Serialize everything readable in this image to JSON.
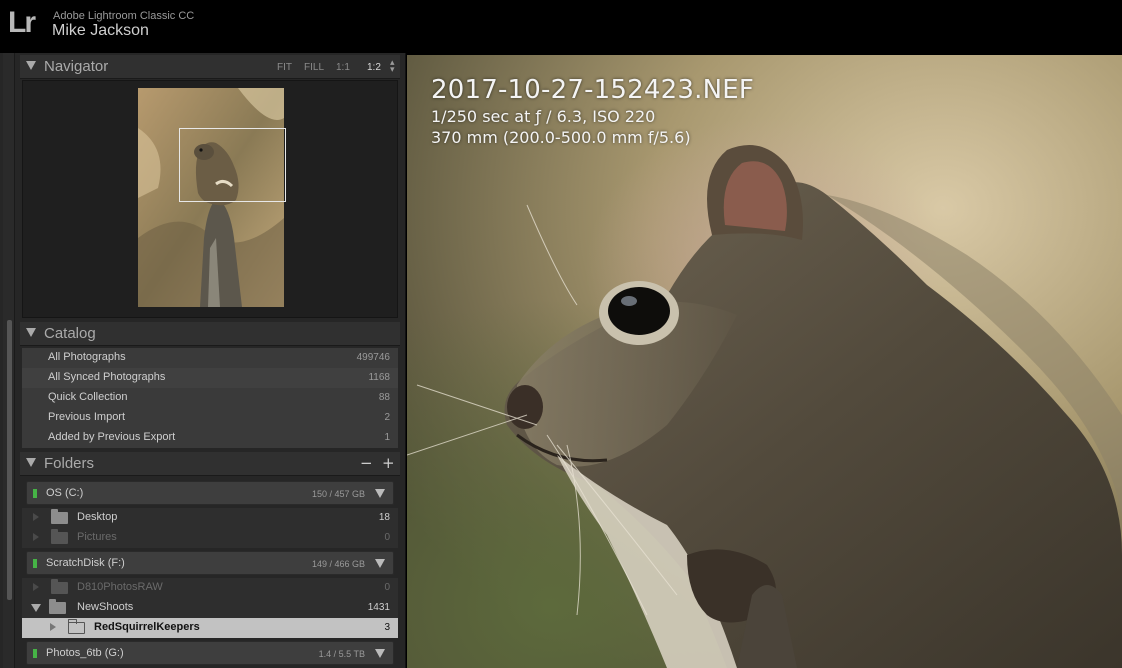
{
  "app": {
    "logo": "Lr",
    "name": "Adobe Lightroom Classic CC",
    "user": "Mike Jackson"
  },
  "navigator": {
    "title": "Navigator",
    "zoom_options": [
      "FIT",
      "FILL",
      "1:1",
      "1:2"
    ],
    "active_zoom": "1:2"
  },
  "catalog": {
    "title": "Catalog",
    "items": [
      {
        "label": "All Photographs",
        "count": "499746"
      },
      {
        "label": "All Synced Photographs",
        "count": "1168"
      },
      {
        "label": "Quick Collection",
        "count": "88"
      },
      {
        "label": "Previous Import",
        "count": "2"
      },
      {
        "label": "Added by Previous Export",
        "count": "1"
      }
    ]
  },
  "folders": {
    "title": "Folders",
    "minus": "−",
    "plus": "+",
    "volumes": [
      {
        "name": "OS (C:)",
        "size": "150 / 457 GB"
      },
      {
        "name": "ScratchDisk (F:)",
        "size": "149 / 466 GB"
      },
      {
        "name": "Photos_6tb (G:)",
        "size": "1.4 / 5.5 TB"
      }
    ],
    "rows": [
      {
        "name": "Desktop",
        "count": "18"
      },
      {
        "name": "Pictures",
        "count": "0"
      },
      {
        "name": "D810PhotosRAW",
        "count": "0"
      },
      {
        "name": "NewShoots",
        "count": "1431"
      },
      {
        "name": "RedSquirrelKeepers",
        "count": "3"
      }
    ]
  },
  "photo": {
    "filename": "2017-10-27-152423.NEF",
    "exposure": "1/250 sec at ƒ / 6.3, ISO 220",
    "lens": "370 mm (200.0-500.0 mm f/5.6)"
  },
  "colors": {
    "panel_bg": "#262626",
    "header_bg": "#303030",
    "selected_row": "#c2c2c2",
    "volume_led": "#46b346"
  }
}
